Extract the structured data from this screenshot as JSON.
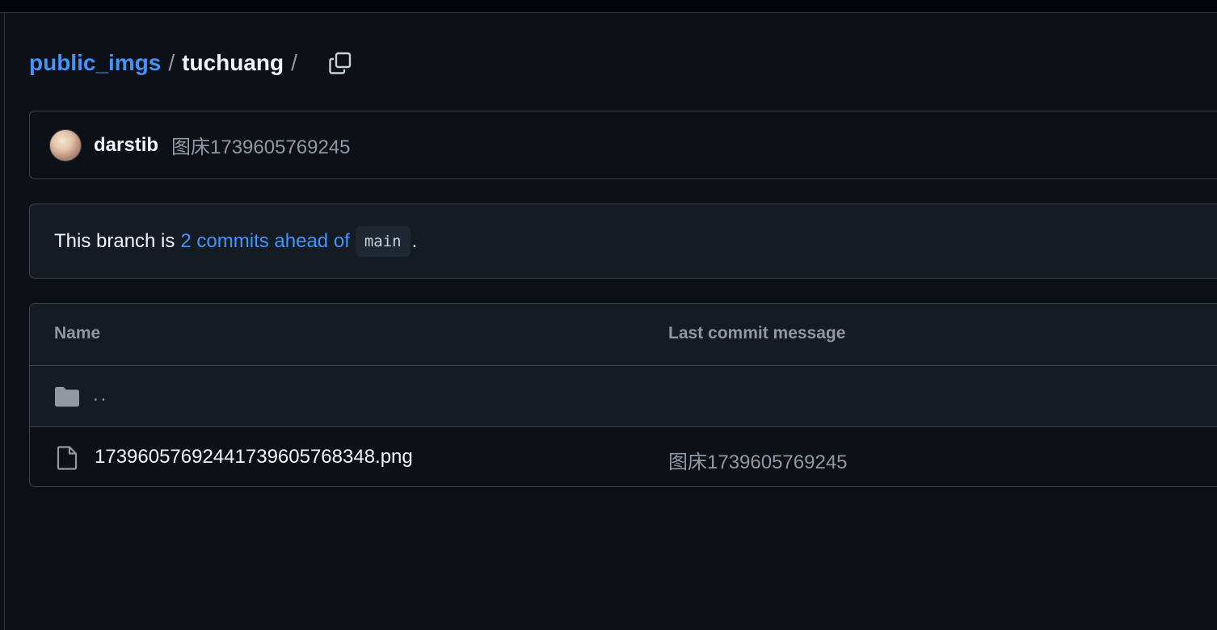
{
  "breadcrumb": {
    "repo": "public_imgs",
    "separator": "/",
    "folder": "tuchuang",
    "trailing_separator": "/",
    "copy_icon": "copy-icon"
  },
  "latest_commit": {
    "author": "darstib",
    "message": "图床1739605769245"
  },
  "branch_status": {
    "prefix": "This branch is",
    "link_text": "2 commits ahead of",
    "base_branch": "main",
    "suffix": "."
  },
  "files": {
    "columns": {
      "name": "Name",
      "last_commit_message": "Last commit message"
    },
    "parent_row": {
      "label": "..",
      "icon": "folder-icon"
    },
    "rows": [
      {
        "name": "17396057692441739605768348.png",
        "message": "图床1739605769245",
        "icon": "file-icon"
      }
    ]
  },
  "colors": {
    "background": "#0d1117",
    "link": "#4493f8",
    "muted": "#9198a1",
    "border": "#3d444d",
    "panel": "#151b23"
  }
}
